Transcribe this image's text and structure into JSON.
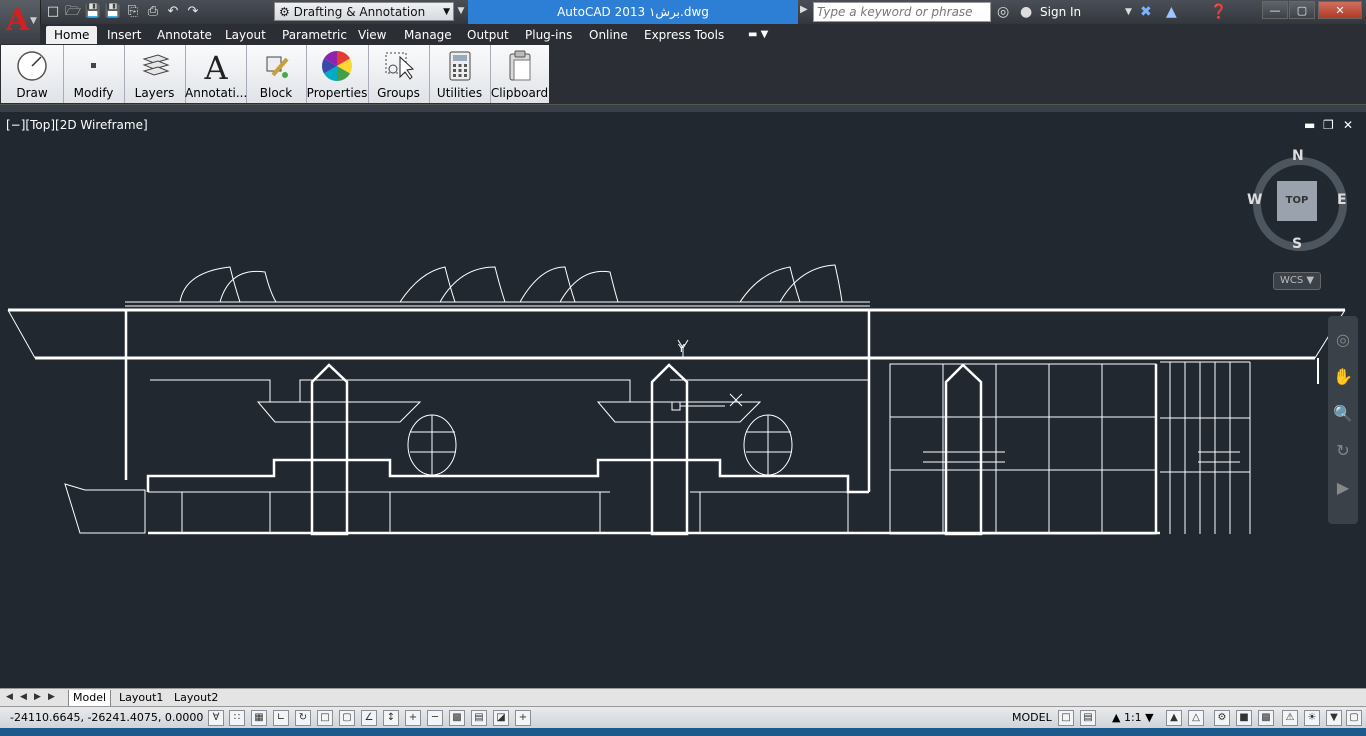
{
  "app": {
    "letter": "A"
  },
  "workspace": {
    "label": "Drafting & Annotation"
  },
  "document": {
    "title": "AutoCAD 2013    برش۱.dwg"
  },
  "search": {
    "placeholder": "Type a keyword or phrase"
  },
  "account": {
    "sign_in": "Sign In"
  },
  "tabs": [
    "Home",
    "Insert",
    "Annotate",
    "Layout",
    "Parametric",
    "View",
    "Manage",
    "Output",
    "Plug-ins",
    "Online",
    "Express Tools"
  ],
  "ribbon_panels": [
    {
      "label": "Draw",
      "icon": "draw-icon"
    },
    {
      "label": "Modify",
      "icon": "modify-icon"
    },
    {
      "label": "Layers",
      "icon": "layers-icon"
    },
    {
      "label": "Annotati...",
      "icon": "annotation-icon"
    },
    {
      "label": "Block",
      "icon": "block-icon"
    },
    {
      "label": "Properties",
      "icon": "color-wheel-icon"
    },
    {
      "label": "Groups",
      "icon": "groups-icon"
    },
    {
      "label": "Utilities",
      "icon": "calculator-icon"
    },
    {
      "label": "Clipboard",
      "icon": "clipboard-icon"
    }
  ],
  "viewport": {
    "label": "[−][Top][2D Wireframe]"
  },
  "viewcube": {
    "north": "N",
    "south": "S",
    "east": "E",
    "west": "W",
    "face": "TOP",
    "wcs": "WCS"
  },
  "ucs": {
    "y_label": "Y"
  },
  "layout_tabs": [
    "Model",
    "Layout1",
    "Layout2"
  ],
  "status": {
    "coordinates": "-24110.6645, -26241.4075, 0.0000",
    "model": "MODEL",
    "scale": "1:1"
  },
  "colors": {
    "viewport_bg": "#212830",
    "drawing_lines": "#ffffff",
    "doc_title_bg": "#2c7fd4",
    "app_letter": "#d42020"
  }
}
